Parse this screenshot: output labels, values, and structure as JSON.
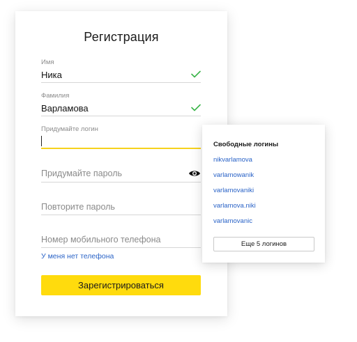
{
  "form": {
    "title": "Регистрация",
    "first_name": {
      "label": "Имя",
      "value": "Ника"
    },
    "last_name": {
      "label": "Фамилия",
      "value": "Варламова"
    },
    "login": {
      "label": "Придумайте логин",
      "value": ""
    },
    "password": {
      "placeholder": "Придумайте пароль"
    },
    "password_repeat": {
      "placeholder": "Повторите пароль"
    },
    "phone": {
      "placeholder": "Номер мобильного телефона"
    },
    "no_phone_link": "У меня нет телефона",
    "submit_label": "Зарегистрироваться"
  },
  "suggestions": {
    "title": "Свободные логины",
    "items": [
      "nikvarlamova",
      "varlamowanik",
      "varlamovaniki",
      "varlamova.niki",
      "varlamovanic"
    ],
    "more_label": "Еще 5 логинов"
  },
  "colors": {
    "accent_yellow": "#ffdb0d",
    "link_blue": "#2a63c7",
    "check_green": "#3bb54a"
  },
  "icons": {
    "valid": "check-icon",
    "toggle_visibility": "eye-icon"
  }
}
